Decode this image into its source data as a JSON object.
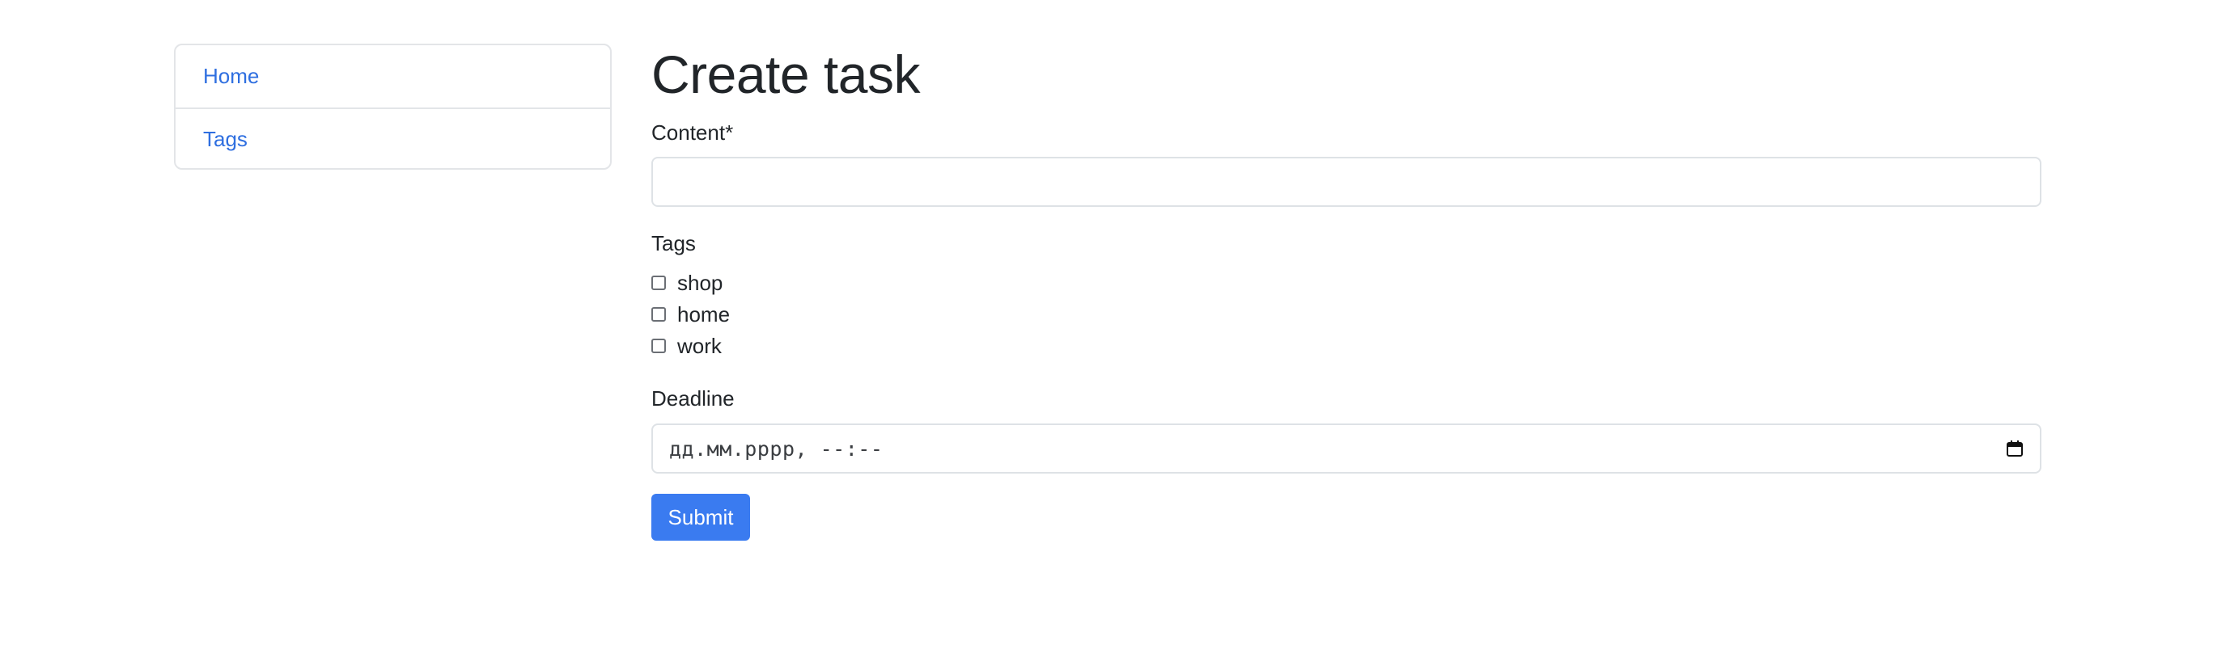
{
  "sidebar": {
    "items": [
      {
        "label": "Home"
      },
      {
        "label": "Tags"
      }
    ]
  },
  "main": {
    "title": "Create task",
    "content_label": "Content*",
    "content_value": "",
    "tags_label": "Tags",
    "tags": [
      {
        "label": "shop",
        "checked": false
      },
      {
        "label": "home",
        "checked": false
      },
      {
        "label": "work",
        "checked": false
      }
    ],
    "deadline_label": "Deadline",
    "deadline_placeholder": "дд.мм.рррр, --:--",
    "submit_label": "Submit"
  },
  "colors": {
    "link": "#2f6fe0",
    "primary_button": "#3a7bf0",
    "border": "#dee2e6"
  },
  "icons": {
    "deadline_picker": "calendar-icon"
  }
}
